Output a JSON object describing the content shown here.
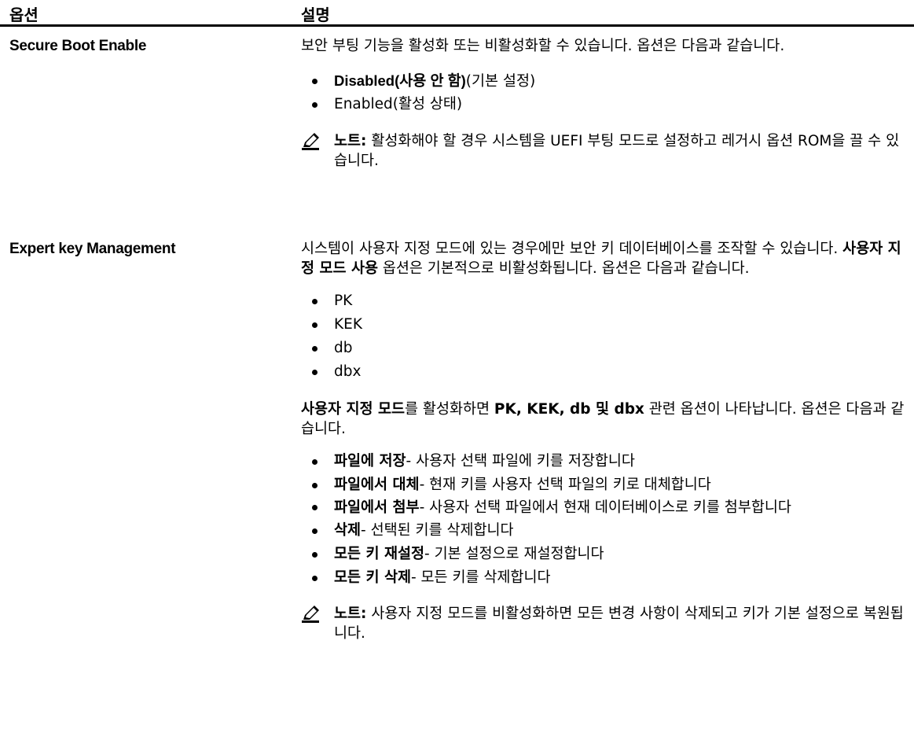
{
  "header": {
    "option": "옵션",
    "description": "설명"
  },
  "rows": [
    {
      "option": "Secure Boot Enable",
      "intro": "보안 부팅 기능을 활성화 또는 비활성화할 수 있습니다. 옵션은 다음과 같습니다.",
      "choices": [
        {
          "main": "Disabled(사용 안 함)",
          "suffix": "(기본 설정)"
        },
        {
          "main": "Enabled(활성 상태)"
        }
      ],
      "note": {
        "label": "노트:",
        "text": " 활성화해야 할 경우 시스템을 UEFI 부팅 모드로 설정하고 레거시 옵션 ROM을 끌 수 있습니다."
      }
    },
    {
      "option": "Expert key Management",
      "intro": {
        "a": "시스템이 사용자 지정 모드에 있는 경우에만 보안 키 데이터베이스를 조작할 수 있습니다. ",
        "b": "사용자 지정 모드 사용",
        "c": " 옵션은 기본적으로 비활성화됩니다. 옵션은 다음과 같습니다."
      },
      "keys": [
        "PK",
        "KEK",
        "db",
        "dbx"
      ],
      "intro2": {
        "a": "사용자 지정 모드",
        "b": "를 활성화하면 ",
        "c": "PK, KEK, db 및 dbx",
        "d": " 관련 옵션이 나타납니다. 옵션은 다음과 같습니다."
      },
      "actions": [
        {
          "label": "파일에 저장",
          "desc": "- 사용자 선택 파일에 키를 저장합니다"
        },
        {
          "label": "파일에서 대체",
          "desc": "- 현재 키를 사용자 선택 파일의 키로 대체합니다"
        },
        {
          "label": "파일에서 첨부",
          "desc": "- 사용자 선택 파일에서 현재 데이터베이스로 키를 첨부합니다"
        },
        {
          "label": "삭제",
          "desc": "- 선택된 키를 삭제합니다"
        },
        {
          "label": "모든 키 재설정",
          "desc": "- 기본 설정으로 재설정합니다"
        },
        {
          "label": "모든 키 삭제",
          "desc": "- 모든 키를 삭제합니다"
        }
      ],
      "note": {
        "label": "노트:",
        "text": " 사용자 지정 모드를 비활성화하면 모든 변경 사항이 삭제되고 키가 기본 설정으로 복원됩니다."
      }
    }
  ],
  "icons": {
    "note": "pencil-note-icon"
  }
}
